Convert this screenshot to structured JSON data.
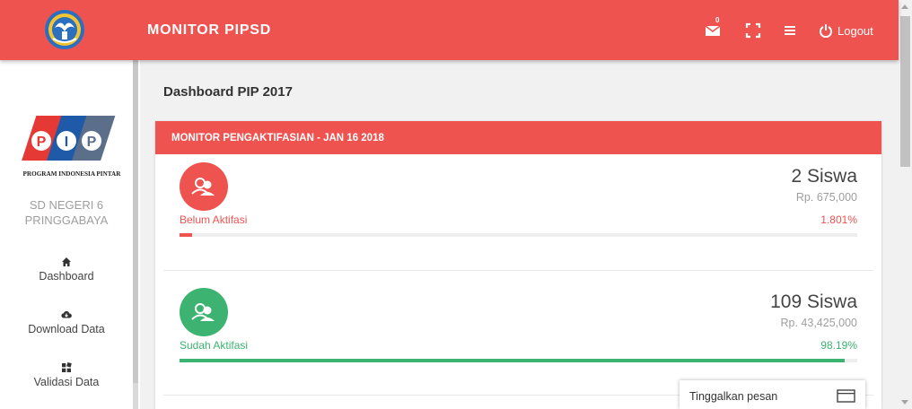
{
  "header": {
    "title": "MONITOR PIPSD",
    "mail_count": "0",
    "logout_label": "Logout"
  },
  "sidebar": {
    "logo_caption": "PROGRAM INDONESIA PINTAR",
    "logo_letters": [
      "P",
      "I",
      "P"
    ],
    "school_line1": "SD NEGERI 6",
    "school_line2": "PRINGGABAYA",
    "items": [
      {
        "label": "Dashboard",
        "icon": "home-icon"
      },
      {
        "label": "Download Data",
        "icon": "cloud-download-icon"
      },
      {
        "label": "Validasi Data",
        "icon": "grid-icon"
      }
    ]
  },
  "main": {
    "page_title": "Dashboard PIP 2017",
    "card_title": "MONITOR PENGAKTIFASIAN - JAN 16 2018",
    "stats": [
      {
        "label": "Belum Aktifasi",
        "count": "2 Siswa",
        "amount": "Rp. 675,000",
        "percent_text": "1.801%",
        "percent": 1.801,
        "color": "#ef5350"
      },
      {
        "label": "Sudah Aktifasi",
        "count": "109 Siswa",
        "amount": "Rp. 43,425,000",
        "percent_text": "98.19%",
        "percent": 98.19,
        "color": "#3cb371"
      }
    ]
  },
  "chat": {
    "label": "Tinggalkan pesan"
  },
  "colors": {
    "brand": "#ef5350",
    "success": "#3cb371"
  }
}
